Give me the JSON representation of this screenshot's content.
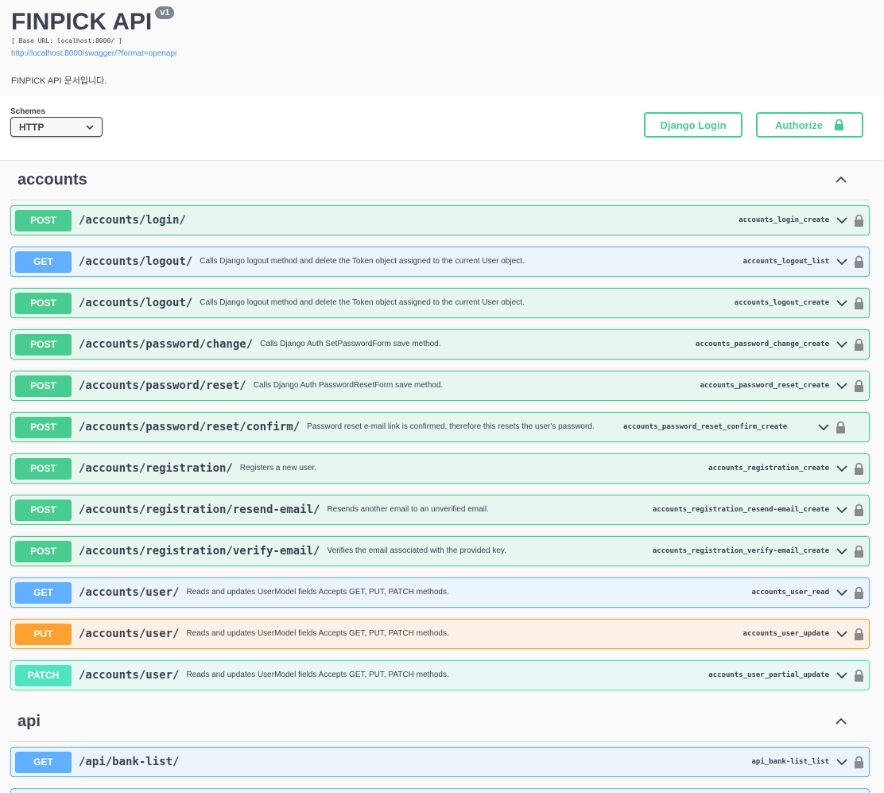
{
  "info": {
    "title": "FINPICK API",
    "version": "v1",
    "base_url": "[ Base URL: localhost:8000/ ]",
    "spec_link": "http://localhost:8000/swagger/?format=openapi",
    "description": "FINPICK API 문서입니다."
  },
  "schemes": {
    "label": "Schemes",
    "selected": "HTTP"
  },
  "buttons": {
    "django_login": "Django Login",
    "authorize": "Authorize"
  },
  "colors": {
    "post": "#49cc90",
    "get": "#61affe",
    "put": "#fca130",
    "patch": "#50e3c2"
  },
  "tags": [
    {
      "name": "accounts",
      "operations": [
        {
          "method": "POST",
          "path": "/accounts/login/",
          "summary": "",
          "operation_id": "accounts_login_create"
        },
        {
          "method": "GET",
          "path": "/accounts/logout/",
          "summary": "Calls Django logout method and delete the Token object assigned to the current User object.",
          "operation_id": "accounts_logout_list"
        },
        {
          "method": "POST",
          "path": "/accounts/logout/",
          "summary": "Calls Django logout method and delete the Token object assigned to the current User object.",
          "operation_id": "accounts_logout_create"
        },
        {
          "method": "POST",
          "path": "/accounts/password/change/",
          "summary": "Calls Django Auth SetPasswordForm save method.",
          "operation_id": "accounts_password_change_create"
        },
        {
          "method": "POST",
          "path": "/accounts/password/reset/",
          "summary": "Calls Django Auth PasswordResetForm save method.",
          "operation_id": "accounts_password_reset_create"
        },
        {
          "method": "POST",
          "path": "/accounts/password/reset/confirm/",
          "summary": "Password reset e-mail link is confirmed, therefore this resets the user's password.",
          "operation_id": "accounts_password_reset_confirm_create"
        },
        {
          "method": "POST",
          "path": "/accounts/registration/",
          "summary": "Registers a new user.",
          "operation_id": "accounts_registration_create"
        },
        {
          "method": "POST",
          "path": "/accounts/registration/resend-email/",
          "summary": "Resends another email to an unverified email.",
          "operation_id": "accounts_registration_resend-email_create"
        },
        {
          "method": "POST",
          "path": "/accounts/registration/verify-email/",
          "summary": "Verifies the email associated with the provided key.",
          "operation_id": "accounts_registration_verify-email_create"
        },
        {
          "method": "GET",
          "path": "/accounts/user/",
          "summary": "Reads and updates UserModel fields Accepts GET, PUT, PATCH methods.",
          "operation_id": "accounts_user_read"
        },
        {
          "method": "PUT",
          "path": "/accounts/user/",
          "summary": "Reads and updates UserModel fields Accepts GET, PUT, PATCH methods.",
          "operation_id": "accounts_user_update"
        },
        {
          "method": "PATCH",
          "path": "/accounts/user/",
          "summary": "Reads and updates UserModel fields Accepts GET, PUT, PATCH methods.",
          "operation_id": "accounts_user_partial_update"
        }
      ]
    },
    {
      "name": "api",
      "operations": [
        {
          "method": "GET",
          "path": "/api/bank-list/",
          "summary": "",
          "operation_id": "api_bank-list_list"
        }
      ]
    }
  ]
}
